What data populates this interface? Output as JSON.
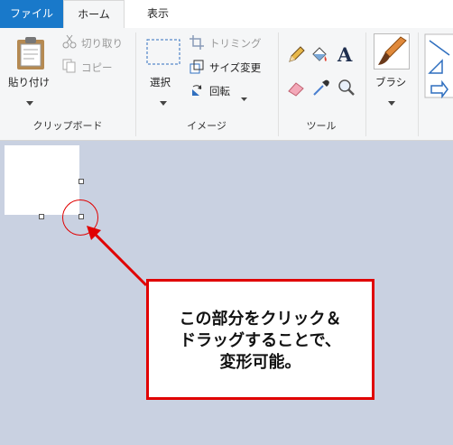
{
  "tabs": {
    "file": "ファイル",
    "home": "ホーム",
    "view": "表示"
  },
  "clipboard": {
    "paste": "貼り付け",
    "cut": "切り取り",
    "copy": "コピー",
    "group": "クリップボード"
  },
  "image": {
    "select": "選択",
    "crop": "トリミング",
    "resize": "サイズ変更",
    "rotate": "回転",
    "group": "イメージ"
  },
  "tools": {
    "group": "ツール"
  },
  "brushes": {
    "label": "ブラシ"
  },
  "callout": {
    "lines": [
      "この部分をクリック＆",
      "ドラッグすることで、",
      "変形可能。"
    ]
  },
  "colors": {
    "file_tab": "#1979ca",
    "annotation": "#e00000",
    "workspace": "#c9d1e1"
  }
}
